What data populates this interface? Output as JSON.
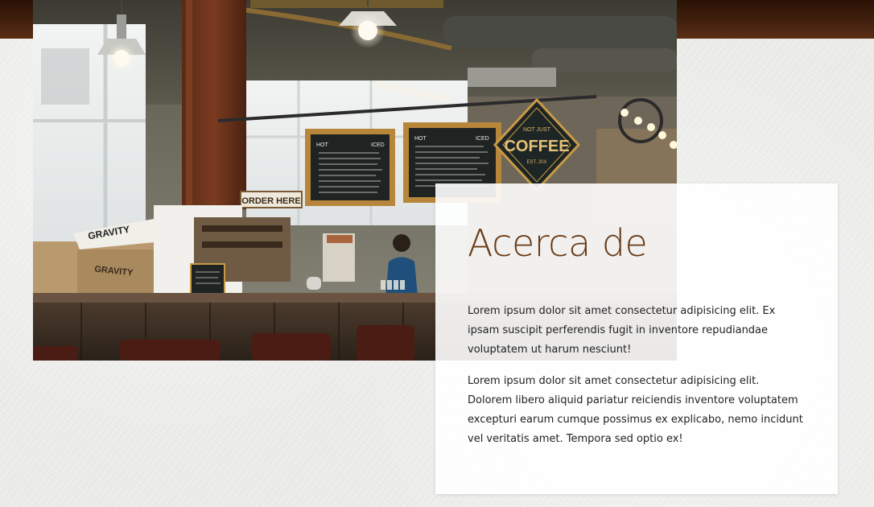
{
  "about": {
    "title": "Acerca de",
    "paragraphs": [
      "Lorem ipsum dolor sit amet consectetur adipisicing elit. Ex ipsam suscipit perferendis fugit in inventore repudiandae voluptatem ut harum nesciunt!",
      "Lorem ipsum dolor sit amet consectetur adipisicing elit. Dolorem libero aliquid pariatur reiciendis inventore voluptatem excepturi earum cumque possimus ex explicabo, nemo incidunt vel veritatis amet. Tempora sed optio ex!"
    ]
  },
  "photo": {
    "coffee_sign_top": "NOT JUST",
    "coffee_sign_main": "COFFEE",
    "coffee_sign_bottom": "EST. 20X",
    "order_sign": "ORDER HERE",
    "menu_left_header": "HOT",
    "menu_left_header2": "ICED",
    "menu_right_header": "HOT",
    "menu_right_header2": "ICED",
    "crate_label": "GRAVITY",
    "box_label": "GRAVITY"
  },
  "colors": {
    "title": "#6a3b16",
    "top_strip": "#3d1d0c",
    "page_background": "#ededeb"
  }
}
